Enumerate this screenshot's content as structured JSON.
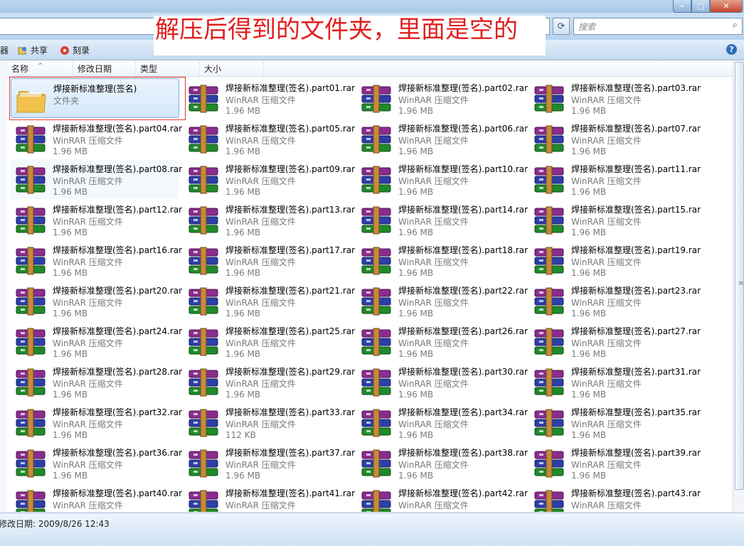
{
  "annotation": "解压后得到的文件夹，里面是空的",
  "search": {
    "placeholder": "搜索"
  },
  "window_buttons": {
    "minimize": "–",
    "maximize": "□",
    "close": "✕"
  },
  "toolbar": {
    "organize_fragment": "器",
    "share_label": "共享",
    "burn_label": "刻录",
    "help_label": "?"
  },
  "columns": [
    "名称",
    "修改日期",
    "类型",
    "大小"
  ],
  "items": [
    {
      "name": "焊接新标准整理(签名)",
      "type": "文件夹",
      "size": "",
      "icon": "folder-icon",
      "selected": true
    },
    {
      "name": "焊接新标准整理(签名).part01.rar",
      "type": "WinRAR 压缩文件",
      "size": "1.96 MB",
      "icon": "winrar-icon"
    },
    {
      "name": "焊接新标准整理(签名).part02.rar",
      "type": "WinRAR 压缩文件",
      "size": "1.96 MB",
      "icon": "winrar-icon"
    },
    {
      "name": "焊接新标准整理(签名).part03.rar",
      "type": "WinRAR 压缩文件",
      "size": "1.96 MB",
      "icon": "winrar-icon"
    },
    {
      "name": "焊接新标准整理(签名).part04.rar",
      "type": "WinRAR 压缩文件",
      "size": "1.96 MB",
      "icon": "winrar-icon"
    },
    {
      "name": "焊接新标准整理(签名).part05.rar",
      "type": "WinRAR 压缩文件",
      "size": "1.96 MB",
      "icon": "winrar-icon"
    },
    {
      "name": "焊接新标准整理(签名).part06.rar",
      "type": "WinRAR 压缩文件",
      "size": "1.96 MB",
      "icon": "winrar-icon"
    },
    {
      "name": "焊接新标准整理(签名).part07.rar",
      "type": "WinRAR 压缩文件",
      "size": "1.96 MB",
      "icon": "winrar-icon"
    },
    {
      "name": "焊接新标准整理(签名).part08.rar",
      "type": "WinRAR 压缩文件",
      "size": "1.96 MB",
      "icon": "winrar-icon",
      "hovered": true
    },
    {
      "name": "焊接新标准整理(签名).part09.rar",
      "type": "WinRAR 压缩文件",
      "size": "1.96 MB",
      "icon": "winrar-icon"
    },
    {
      "name": "焊接新标准整理(签名).part10.rar",
      "type": "WinRAR 压缩文件",
      "size": "1.96 MB",
      "icon": "winrar-icon"
    },
    {
      "name": "焊接新标准整理(签名).part11.rar",
      "type": "WinRAR 压缩文件",
      "size": "1.96 MB",
      "icon": "winrar-icon"
    },
    {
      "name": "焊接新标准整理(签名).part12.rar",
      "type": "WinRAR 压缩文件",
      "size": "1.96 MB",
      "icon": "winrar-icon"
    },
    {
      "name": "焊接新标准整理(签名).part13.rar",
      "type": "WinRAR 压缩文件",
      "size": "1.96 MB",
      "icon": "winrar-icon"
    },
    {
      "name": "焊接新标准整理(签名).part14.rar",
      "type": "WinRAR 压缩文件",
      "size": "1.96 MB",
      "icon": "winrar-icon"
    },
    {
      "name": "焊接新标准整理(签名).part15.rar",
      "type": "WinRAR 压缩文件",
      "size": "1.96 MB",
      "icon": "winrar-icon"
    },
    {
      "name": "焊接新标准整理(签名).part16.rar",
      "type": "WinRAR 压缩文件",
      "size": "1.96 MB",
      "icon": "winrar-icon"
    },
    {
      "name": "焊接新标准整理(签名).part17.rar",
      "type": "WinRAR 压缩文件",
      "size": "1.96 MB",
      "icon": "winrar-icon"
    },
    {
      "name": "焊接新标准整理(签名).part18.rar",
      "type": "WinRAR 压缩文件",
      "size": "1.96 MB",
      "icon": "winrar-icon"
    },
    {
      "name": "焊接新标准整理(签名).part19.rar",
      "type": "WinRAR 压缩文件",
      "size": "1.96 MB",
      "icon": "winrar-icon"
    },
    {
      "name": "焊接新标准整理(签名).part20.rar",
      "type": "WinRAR 压缩文件",
      "size": "1.96 MB",
      "icon": "winrar-icon"
    },
    {
      "name": "焊接新标准整理(签名).part21.rar",
      "type": "WinRAR 压缩文件",
      "size": "1.96 MB",
      "icon": "winrar-icon"
    },
    {
      "name": "焊接新标准整理(签名).part22.rar",
      "type": "WinRAR 压缩文件",
      "size": "1.96 MB",
      "icon": "winrar-icon"
    },
    {
      "name": "焊接新标准整理(签名).part23.rar",
      "type": "WinRAR 压缩文件",
      "size": "1.96 MB",
      "icon": "winrar-icon"
    },
    {
      "name": "焊接新标准整理(签名).part24.rar",
      "type": "WinRAR 压缩文件",
      "size": "1.96 MB",
      "icon": "winrar-icon"
    },
    {
      "name": "焊接新标准整理(签名).part25.rar",
      "type": "WinRAR 压缩文件",
      "size": "1.96 MB",
      "icon": "winrar-icon"
    },
    {
      "name": "焊接新标准整理(签名).part26.rar",
      "type": "WinRAR 压缩文件",
      "size": "1.96 MB",
      "icon": "winrar-icon"
    },
    {
      "name": "焊接新标准整理(签名).part27.rar",
      "type": "WinRAR 压缩文件",
      "size": "1.96 MB",
      "icon": "winrar-icon"
    },
    {
      "name": "焊接新标准整理(签名).part28.rar",
      "type": "WinRAR 压缩文件",
      "size": "1.96 MB",
      "icon": "winrar-icon"
    },
    {
      "name": "焊接新标准整理(签名).part29.rar",
      "type": "WinRAR 压缩文件",
      "size": "1.96 MB",
      "icon": "winrar-icon"
    },
    {
      "name": "焊接新标准整理(签名).part30.rar",
      "type": "WinRAR 压缩文件",
      "size": "1.96 MB",
      "icon": "winrar-icon"
    },
    {
      "name": "焊接新标准整理(签名).part31.rar",
      "type": "WinRAR 压缩文件",
      "size": "1.96 MB",
      "icon": "winrar-icon"
    },
    {
      "name": "焊接新标准整理(签名).part32.rar",
      "type": "WinRAR 压缩文件",
      "size": "1.96 MB",
      "icon": "winrar-icon"
    },
    {
      "name": "焊接新标准整理(签名).part33.rar",
      "type": "WinRAR 压缩文件",
      "size": "112 KB",
      "icon": "winrar-icon"
    },
    {
      "name": "焊接新标准整理(签名).part34.rar",
      "type": "WinRAR 压缩文件",
      "size": "1.96 MB",
      "icon": "winrar-icon"
    },
    {
      "name": "焊接新标准整理(签名).part35.rar",
      "type": "WinRAR 压缩文件",
      "size": "1.96 MB",
      "icon": "winrar-icon"
    },
    {
      "name": "焊接新标准整理(签名).part36.rar",
      "type": "WinRAR 压缩文件",
      "size": "1.96 MB",
      "icon": "winrar-icon"
    },
    {
      "name": "焊接新标准整理(签名).part37.rar",
      "type": "WinRAR 压缩文件",
      "size": "1.96 MB",
      "icon": "winrar-icon"
    },
    {
      "name": "焊接新标准整理(签名).part38.rar",
      "type": "WinRAR 压缩文件",
      "size": "1.96 MB",
      "icon": "winrar-icon"
    },
    {
      "name": "焊接新标准整理(签名).part39.rar",
      "type": "WinRAR 压缩文件",
      "size": "1.96 MB",
      "icon": "winrar-icon"
    },
    {
      "name": "焊接新标准整理(签名).part40.rar",
      "type": "WinRAR 压缩文件",
      "size": "",
      "icon": "winrar-icon"
    },
    {
      "name": "焊接新标准整理(签名).part41.rar",
      "type": "WinRAR 压缩文件",
      "size": "",
      "icon": "winrar-icon"
    },
    {
      "name": "焊接新标准整理(签名).part42.rar",
      "type": "WinRAR 压缩文件",
      "size": "",
      "icon": "winrar-icon"
    },
    {
      "name": "焊接新标准整理(签名).part43.rar",
      "type": "WinRAR 压缩文件",
      "size": "",
      "icon": "winrar-icon"
    }
  ],
  "status": {
    "modified": "修改日期: 2009/8/26 12:43"
  },
  "colors": {
    "annotation_text": "#e02020",
    "selection_outline": "#e13b30",
    "folder": "#f0c14b",
    "rar_purple": "#8b2c8f",
    "rar_blue": "#2c3fa8",
    "rar_green": "#1f8a2a",
    "secondary_text": "#7b7b7b"
  }
}
